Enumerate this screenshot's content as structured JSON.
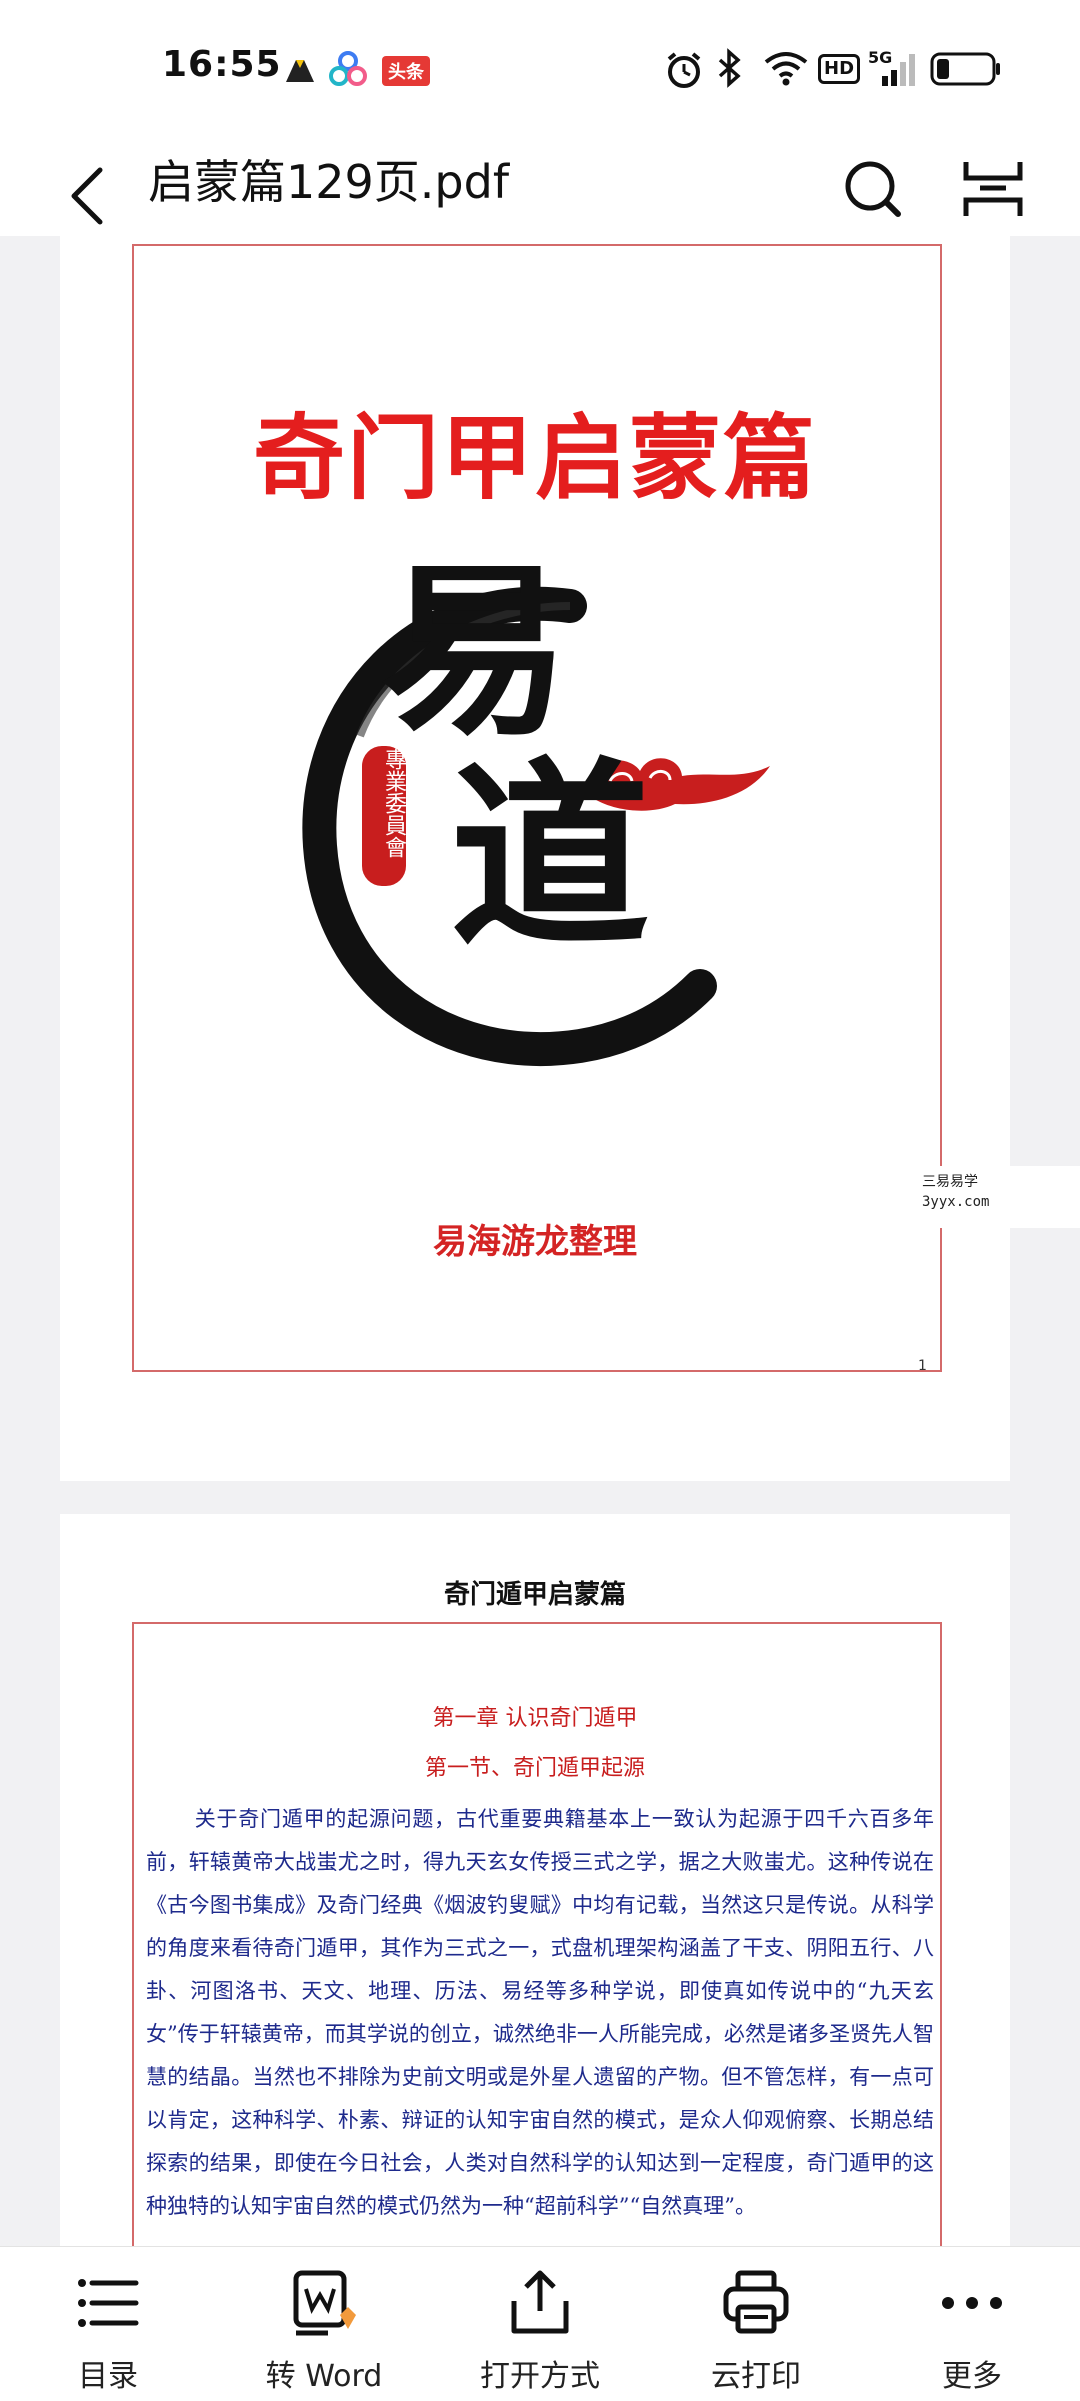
{
  "status_bar": {
    "time": "16:55",
    "toutiao_badge": "头条",
    "hd": "HD",
    "network": "5G",
    "icons": [
      "android-icon",
      "app-icon",
      "alarm-icon",
      "bluetooth-icon",
      "wifi-icon",
      "signal-icon",
      "battery-icon"
    ]
  },
  "header": {
    "title": "启蒙篇129页.pdf"
  },
  "page1": {
    "cover_title": "奇门甲启蒙篇",
    "logo_chars": [
      "易",
      "道"
    ],
    "seal_text": "專業委員會",
    "compiler": "易海游龙整理",
    "page_number": "1",
    "watermark_line1": "三易易学",
    "watermark_line2": "3yyx.com"
  },
  "page2": {
    "header": "奇门遁甲启蒙篇",
    "chapter": "第一章  认识奇门遁甲",
    "section": "第一节、奇门遁甲起源",
    "body": "关于奇门遁甲的起源问题，古代重要典籍基本上一致认为起源于四千六百多年前，轩辕黄帝大战蚩尤之时，得九天玄女传授三式之学，据之大败蚩尤。这种传说在《古今图书集成》及奇门经典《烟波钓叟赋》中均有记载，当然这只是传说。从科学的角度来看待奇门遁甲，其作为三式之一，式盘机理架构涵盖了干支、阴阳五行、八卦、河图洛书、天文、地理、历法、易经等多种学说，即使真如传说中的“九天玄女”传于轩辕黄帝，而其学说的创立，诚然绝非一人所能完成，必然是诸多圣贤先人智慧的结晶。当然也不排除为史前文明或是外星人遗留的产物。但不管怎样，有一点可以肯定，这种科学、朴素、辩证的认知宇宙自然的模式，是众人仰观俯察、长期总结探索的结果，即使在今日社会，人类对自然科学的认知达到一定程度，奇门遁甲的这种独特的认知宇宙自然的模式仍然为一种“超前科学”“自然真理”。"
  },
  "toolbar": {
    "items": [
      {
        "label": "目录",
        "icon": "list-icon"
      },
      {
        "label": "转 Word",
        "icon": "convert-word-icon"
      },
      {
        "label": "打开方式",
        "icon": "share-icon"
      },
      {
        "label": "云打印",
        "icon": "printer-icon"
      },
      {
        "label": "更多",
        "icon": "more-icon"
      }
    ]
  },
  "colors": {
    "accent_red": "#e41e1e",
    "body_text_blue": "#1e2a8c",
    "frame_red": "#d46a6a"
  }
}
